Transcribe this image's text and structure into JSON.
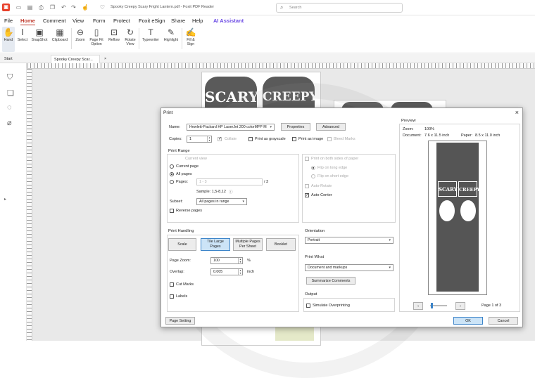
{
  "titlebar": {
    "document_title": "Spooky Creepy Scary Fright Lantern.pdf - Foxit PDF Reader",
    "search_placeholder": "Search"
  },
  "menu": [
    "File",
    "Home",
    "Comment",
    "View",
    "Form",
    "Protect",
    "Foxit eSign",
    "Share",
    "Help",
    "AI Assistant"
  ],
  "ribbon": {
    "hand": "Hand",
    "select": "Select",
    "snapshot": "SnapShot",
    "clipboard": "Clipboard",
    "zoom": "Zoom",
    "page_fit": "Page Fit Option",
    "reflow": "Reflow",
    "rotate": "Rotate View",
    "typewriter": "Typewriter",
    "highlight": "Highlight",
    "fill_sign": "Fill & Sign"
  },
  "tabs": {
    "start": "Start",
    "doc": "Spooky Creepy Scar...",
    "close": "×"
  },
  "page_art": {
    "scary": "SCARY",
    "creepy": "CREEPY"
  },
  "dialog": {
    "title": "Print",
    "close": "×",
    "name_label": "Name:",
    "printer": "Hewlett-Packard HP LaserJet 200 colorMFP M",
    "properties": "Properties",
    "advanced": "Advanced",
    "copies_label": "Copies:",
    "copies": "1",
    "collate": "Collate",
    "print_grayscale": "Print as grayscale",
    "print_image": "Print as image",
    "bleed_marks": "Bleed Marks",
    "print_range": "Print Range",
    "current_view": "Current view",
    "current_page": "Current page",
    "all_pages": "All pages",
    "pages_label": "Pages:",
    "pages_value": "1 - 3",
    "pages_total": "/ 3",
    "sample": "Sample: 1,5-8,12",
    "subset_label": "Subset:",
    "subset": "All pages in range",
    "reverse": "Reverse pages",
    "both_sides": "Print on both sides of paper",
    "flip_long": "Flip on long edge",
    "flip_short": "Flip on short edge",
    "auto_rotate": "Auto-Rotate",
    "auto_center": "Auto-Center",
    "print_handling": "Print Handling",
    "scale": "Scale",
    "tile_large_1": "Tile Large",
    "tile_large_2": "Pages",
    "multiple_1": "Multiple Pages",
    "multiple_2": "Per Sheet",
    "booklet": "Booklet",
    "page_zoom_label": "Page Zoom:",
    "page_zoom": "100",
    "page_zoom_unit": "%",
    "overlap_label": "Overlap:",
    "overlap": "0.005",
    "overlap_unit": "inch",
    "cut_marks": "Cut Marks",
    "labels": "Labels",
    "orientation": "Orientation",
    "orientation_value": "Portrait",
    "print_what": "Print What",
    "print_what_value": "Document and markups",
    "summarize": "Summarize Comments",
    "output": "Output",
    "simulate": "Simulate Overprinting",
    "preview": "Preview",
    "zoom_label": "Zoom:",
    "zoom_value": "100%",
    "doc_size_label": "Document:",
    "doc_size": "7.6 x 11.5 inch",
    "paper_label": "Paper:",
    "paper": "8.5 x 11.0 inch",
    "page_counter": "Page 1 of 3",
    "page_setting": "Page Setting",
    "ok": "OK",
    "cancel": "Cancel",
    "prev_glyph": "‹",
    "next_glyph": "›"
  },
  "colors": {
    "accent": "#c0392b",
    "ai": "#6a49e4",
    "ok_border": "#3c84c9"
  }
}
